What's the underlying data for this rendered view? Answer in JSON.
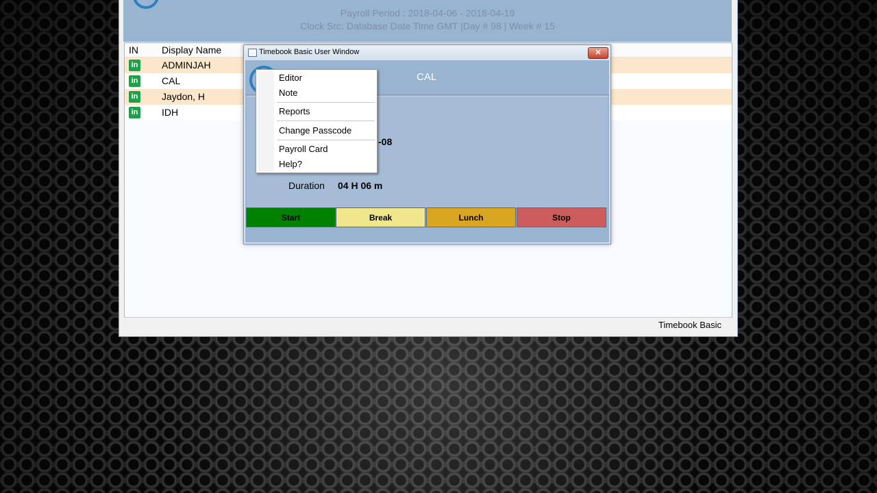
{
  "main_window": {
    "payroll_period": "Payroll Period : 2018-04-06 - 2018-04-19",
    "clock_source": "Clock Src: Database Date Time GMT  |Day # 98 | Week # 15",
    "columns": {
      "in": "IN",
      "display_name": "Display Name"
    },
    "rows": [
      {
        "status_icon": "in-icon",
        "name": "ADMINJAH"
      },
      {
        "status_icon": "in-icon",
        "name": "CAL"
      },
      {
        "status_icon": "in-icon",
        "name": "Jaydon, H"
      },
      {
        "status_icon": "in-icon",
        "name": "IDH"
      }
    ],
    "status_bar": "Timebook Basic"
  },
  "dialog": {
    "title": "Timebook Basic User Window",
    "close_icon": "✕",
    "user_name": "CAL",
    "time_fragment": "-08",
    "duration_label": "Duration",
    "duration_value": "04 H 06 m",
    "buttons": {
      "start": "Start",
      "break": "Break",
      "lunch": "Lunch",
      "stop": "Stop"
    },
    "button_colors": {
      "start": "#008000",
      "break": "#f0e68c",
      "lunch": "#daa520",
      "stop": "#cd5c5c"
    }
  },
  "context_menu": {
    "items": [
      "Editor",
      "Note",
      "Reports",
      "Change Passcode",
      "Payroll Card",
      "Help?"
    ]
  }
}
